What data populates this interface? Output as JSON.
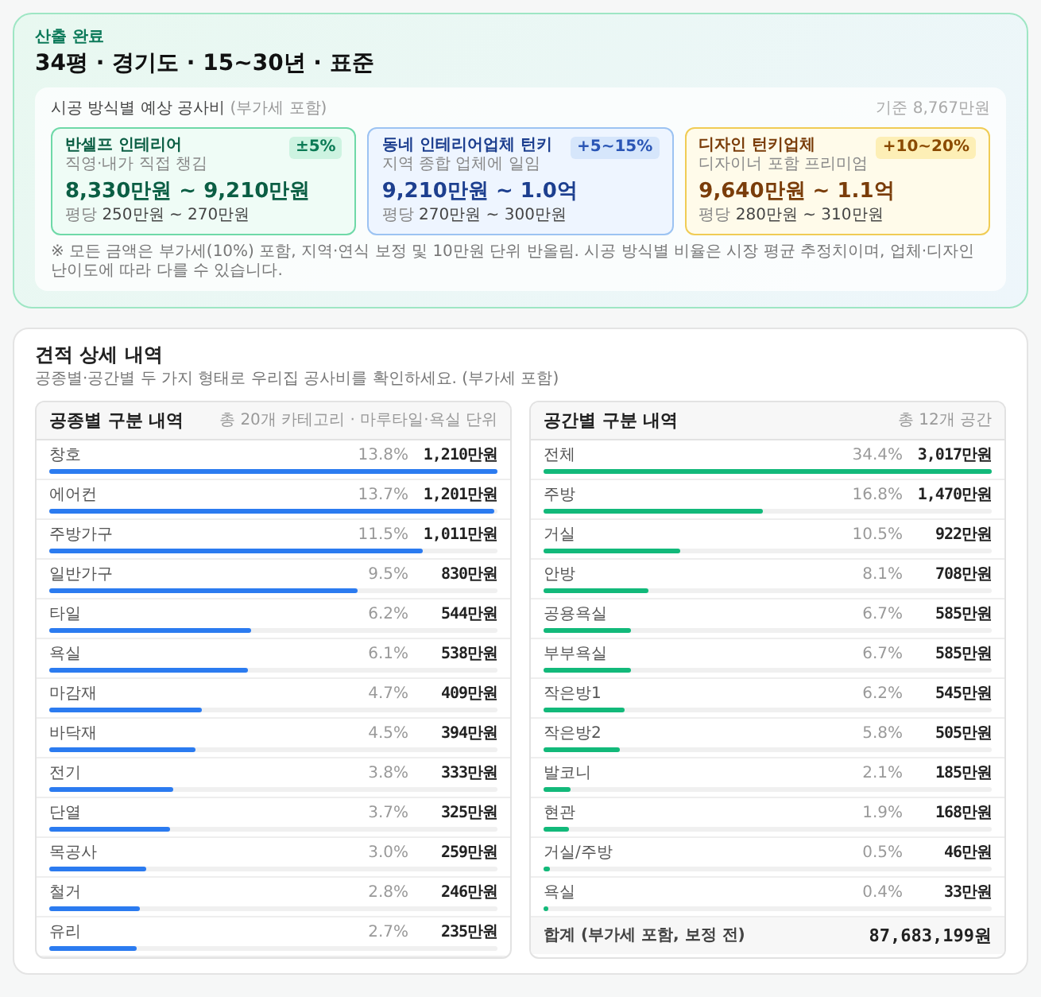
{
  "summary": {
    "status": "산출 완료",
    "title": "34평 · 경기도 · 15~30년 · 표준",
    "estimate": {
      "heading": "시공 방식별 예상 공사비",
      "heading_note": "(부가세 포함)",
      "basis": "기준 8,767만원",
      "options": [
        {
          "kind": "self",
          "name": "반셀프 인테리어",
          "desc": "직영·내가 직접 챙김",
          "badge": "±5%",
          "price": "8,330만원 ~ 9,210만원",
          "per_pyeong_label": "평당",
          "per_pyeong": "250만원 ~ 270만원"
        },
        {
          "kind": "local",
          "name": "동네 인테리어업체 턴키",
          "desc": "지역 종합 업체에 일임",
          "badge": "+5~15%",
          "price": "9,210만원 ~ 1.0억",
          "per_pyeong_label": "평당",
          "per_pyeong": "270만원 ~ 300만원"
        },
        {
          "kind": "design",
          "name": "디자인 턴키업체",
          "desc": "디자이너 포함 프리미엄",
          "badge": "+10~20%",
          "price": "9,640만원 ~ 1.1억",
          "per_pyeong_label": "평당",
          "per_pyeong": "280만원 ~ 310만원"
        }
      ],
      "note": "※ 모든 금액은 부가세(10%) 포함, 지역·연식 보정 및 10만원 단위 반올림. 시공 방식별 비율은 시장 평균 추정치이며, 업체·디자인 난이도에 따라 다를 수 있습니다."
    }
  },
  "detail": {
    "title": "견적 상세 내역",
    "subtitle": "공종별·공간별 두 가지 형태로 우리집 공사비를 확인하세요. (부가세 포함)",
    "panels": [
      {
        "kind": "trade",
        "title": "공종별 구분 내역",
        "meta": "총 20개 카테고리 · 마루타일·욕실 단위",
        "rows": [
          {
            "name": "창호",
            "percent": "13.8%",
            "amount": "1,210만원",
            "level": 1
          },
          {
            "name": "에어컨",
            "percent": "13.7%",
            "amount": "1,201만원",
            "level": 0.993
          },
          {
            "name": "주방가구",
            "percent": "11.5%",
            "amount": "1,011만원",
            "level": 0.833
          },
          {
            "name": "일반가구",
            "percent": "9.5%",
            "amount": "830만원",
            "level": 0.688
          },
          {
            "name": "타일",
            "percent": "6.2%",
            "amount": "544만원",
            "level": 0.449
          },
          {
            "name": "욕실",
            "percent": "6.1%",
            "amount": "538만원",
            "level": 0.442
          },
          {
            "name": "마감재",
            "percent": "4.7%",
            "amount": "409만원",
            "level": 0.341
          },
          {
            "name": "바닥재",
            "percent": "4.5%",
            "amount": "394만원",
            "level": 0.326
          },
          {
            "name": "전기",
            "percent": "3.8%",
            "amount": "333만원",
            "level": 0.275
          },
          {
            "name": "단열",
            "percent": "3.7%",
            "amount": "325만원",
            "level": 0.268
          },
          {
            "name": "목공사",
            "percent": "3.0%",
            "amount": "259만원",
            "level": 0.217
          },
          {
            "name": "철거",
            "percent": "2.8%",
            "amount": "246만원",
            "level": 0.203
          },
          {
            "name": "유리",
            "percent": "2.7%",
            "amount": "235만원",
            "level": 0.196
          }
        ]
      },
      {
        "kind": "space",
        "title": "공간별 구분 내역",
        "meta": "총 12개 공간",
        "rows": [
          {
            "name": "전체",
            "percent": "34.4%",
            "amount": "3,017만원",
            "level": 1
          },
          {
            "name": "주방",
            "percent": "16.8%",
            "amount": "1,470만원",
            "level": 0.488
          },
          {
            "name": "거실",
            "percent": "10.5%",
            "amount": "922만원",
            "level": 0.305
          },
          {
            "name": "안방",
            "percent": "8.1%",
            "amount": "708만원",
            "level": 0.235
          },
          {
            "name": "공용욕실",
            "percent": "6.7%",
            "amount": "585만원",
            "level": 0.195
          },
          {
            "name": "부부욕실",
            "percent": "6.7%",
            "amount": "585만원",
            "level": 0.195
          },
          {
            "name": "작은방1",
            "percent": "6.2%",
            "amount": "545만원",
            "level": 0.18
          },
          {
            "name": "작은방2",
            "percent": "5.8%",
            "amount": "505만원",
            "level": 0.169
          },
          {
            "name": "발코니",
            "percent": "2.1%",
            "amount": "185만원",
            "level": 0.061
          },
          {
            "name": "현관",
            "percent": "1.9%",
            "amount": "168만원",
            "level": 0.055
          },
          {
            "name": "거실/주방",
            "percent": "0.5%",
            "amount": "46만원",
            "level": 0.015
          },
          {
            "name": "욕실",
            "percent": "0.4%",
            "amount": "33만원",
            "level": 0.012
          }
        ],
        "total": {
          "label": "합계 (부가세 포함, 보정 전)",
          "value": "87,683,199원"
        }
      }
    ]
  }
}
